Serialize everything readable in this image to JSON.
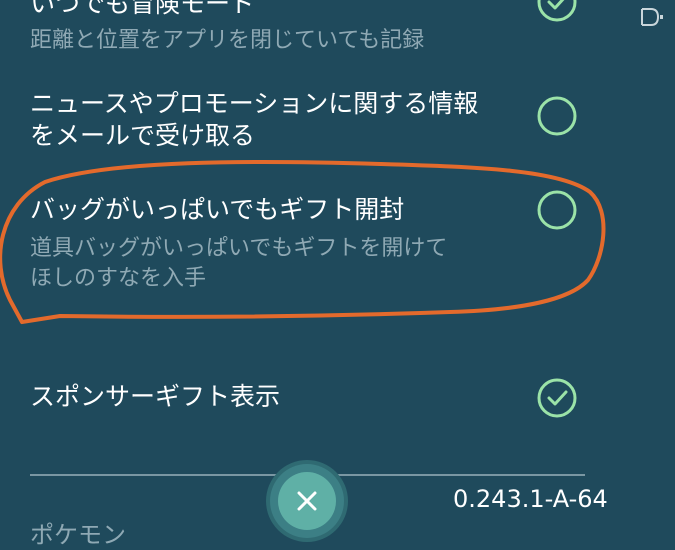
{
  "settings": [
    {
      "title": "いつでも冒険モード",
      "description": "距離と位置をアプリを閉じていても記録",
      "checked": true
    },
    {
      "title": "ニュースやプロモーションに関する情報",
      "title_line2": "をメールで受け取る",
      "checked": false
    },
    {
      "title": "バッグがいっぱいでもギフト開封",
      "description": "道具バッグがいっぱいでもギフトを開けて",
      "description_line2": "ほしのすなを入手",
      "checked": false
    },
    {
      "title": "スポンサーギフト表示",
      "checked": true
    }
  ],
  "footer": {
    "version": "0.243.1-A-64",
    "next_section_label": "ポケモン"
  },
  "icons": {
    "checked": "check-circle-icon",
    "unchecked": "empty-circle-icon",
    "close": "close-icon"
  },
  "colors": {
    "background": "#1f4a5c",
    "toggle": "#9be3a8",
    "annotation": "#e36a2c",
    "close_button": "#5fb0a6"
  }
}
